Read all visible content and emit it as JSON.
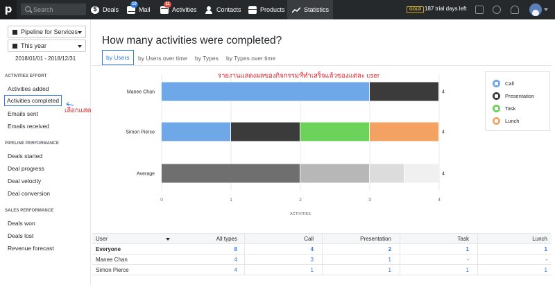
{
  "nav": {
    "search_placeholder": "Search",
    "items": [
      {
        "label": "Deals",
        "icon": "deals-icon"
      },
      {
        "label": "Mail",
        "icon": "mail-icon",
        "badge": "10"
      },
      {
        "label": "Activities",
        "icon": "activities-icon",
        "badge": "11"
      },
      {
        "label": "Contacts",
        "icon": "contacts-icon"
      },
      {
        "label": "Products",
        "icon": "products-icon"
      },
      {
        "label": "Statistics",
        "icon": "statistics-icon"
      }
    ],
    "plan_badge": "GOLD",
    "trial_text": "187 trial days left"
  },
  "sidebar": {
    "pipeline_select": "Pipeline for Services",
    "period_select": "This year",
    "date_range": "2018/01/01 - 2018/12/31",
    "sections": [
      {
        "title": "ACTIVITIES EFFORT",
        "items": [
          "Activities added",
          "Activities completed",
          "Emails sent",
          "Emails received"
        ]
      },
      {
        "title": "PIPELINE PERFORMANCE",
        "items": [
          "Deals started",
          "Deal progress",
          "Deal velocity",
          "Deal conversion"
        ]
      },
      {
        "title": "SALES PERFORMANCE",
        "items": [
          "Deals won",
          "Deals lost",
          "Revenue forecast"
        ]
      }
    ],
    "annotation": "เลือกแสดงแบบ กิจกรรมที่ทำเสร็จแล้ว"
  },
  "main": {
    "title": "How many activities were completed?",
    "tabs": [
      "by Users",
      "by Users over time",
      "by Types",
      "by Types over time"
    ],
    "chart_annotation": "รายงานแสดงผลของกิจกรรมที่ทำเสร็จแล้วของแต่ละ user"
  },
  "chart_data": {
    "type": "bar",
    "orientation": "horizontal",
    "stacked": true,
    "categories": [
      "Manee Chan",
      "Simon Pierce",
      "Average"
    ],
    "series": [
      {
        "name": "Call",
        "values": [
          3,
          1,
          2
        ],
        "color": "#6fa8e9"
      },
      {
        "name": "Presentation",
        "values": [
          1,
          1,
          1
        ],
        "color": "#3b3b3b"
      },
      {
        "name": "Task",
        "values": [
          0,
          1,
          0.5
        ],
        "color": "#6cd35a"
      },
      {
        "name": "Lunch",
        "values": [
          0,
          1,
          0.5
        ],
        "color": "#f4a261"
      }
    ],
    "average_colors": [
      "#6f6f6f",
      "#b7b7b7",
      "#dcdcdc",
      "#f0f0f0"
    ],
    "totals": [
      "4",
      "4",
      "4"
    ],
    "xticks": [
      "0",
      "1",
      "2",
      "3",
      "4"
    ],
    "xlim": [
      0,
      4
    ],
    "xlabel": "ACTIVITIES",
    "legend_position": "right"
  },
  "table": {
    "headers": [
      "User",
      "All types",
      "Call",
      "Presentation",
      "Task",
      "Lunch"
    ],
    "rows": [
      {
        "user": "Everyone",
        "all": "8",
        "call": "4",
        "presentation": "2",
        "task": "1",
        "lunch": "1"
      },
      {
        "user": "Manee Chan",
        "all": "4",
        "call": "3",
        "presentation": "1",
        "task": "-",
        "lunch": "-"
      },
      {
        "user": "Simon Pierce",
        "all": "4",
        "call": "1",
        "presentation": "1",
        "task": "1",
        "lunch": "1"
      }
    ]
  }
}
